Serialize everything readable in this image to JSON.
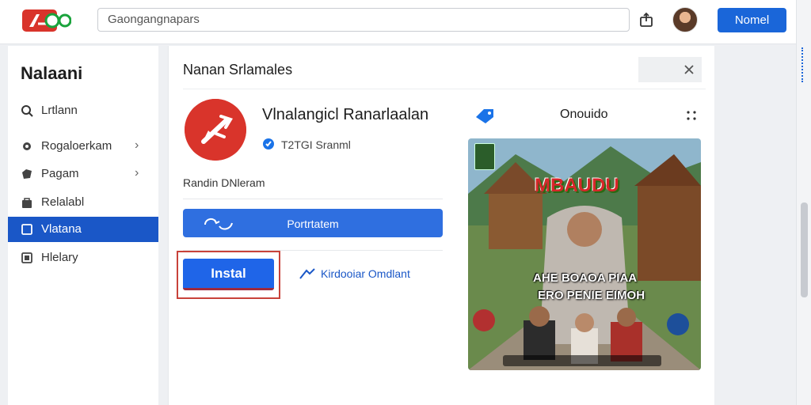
{
  "header": {
    "search_value": "Gaongangnapars",
    "top_button_label": "Nomel"
  },
  "sidebar": {
    "title": "Nalaani",
    "items": [
      {
        "label": "Lrtlann",
        "icon": "search-icon",
        "active": false,
        "has_chevron": false
      },
      {
        "label": "Rogaloerkam",
        "icon": "settings-icon",
        "active": false,
        "has_chevron": true
      },
      {
        "label": "Pagam",
        "icon": "puzzle-icon",
        "active": false,
        "has_chevron": true
      },
      {
        "label": "Relalabl",
        "icon": "bag-icon",
        "active": false,
        "has_chevron": false
      },
      {
        "label": "Vlatana",
        "icon": "box-icon",
        "active": true,
        "has_chevron": false
      },
      {
        "label": "Hlelary",
        "icon": "history-icon",
        "active": false,
        "has_chevron": false
      }
    ]
  },
  "panel": {
    "title": "Nanan Srlamales",
    "app_name": "Vlnalangicl Ranarlaalan",
    "developer": "T2TGI Sranml",
    "rating_text": "Randin DNleram",
    "wide_button_label": "Portrtatem",
    "install_label": "Instal",
    "download_link_label": "Kirdooiar Omdlant"
  },
  "preview": {
    "label": "Onouido",
    "image_title": "MBAUDU",
    "image_sub_1": "AHE BOAOA PIAA",
    "image_sub_2": "ERO PENIE EIMOH"
  },
  "colors": {
    "accent": "#1a66d9",
    "active_nav": "#1a57c7",
    "install_frame": "#c8423a",
    "app_icon": "#d9342b"
  }
}
